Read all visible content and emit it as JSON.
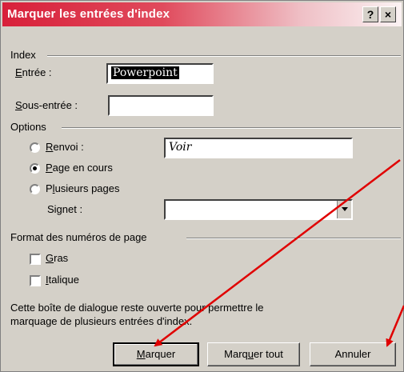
{
  "window": {
    "title": "Marquer les entrées d'index",
    "help_button": "?",
    "close_button": "×"
  },
  "index_group": {
    "label": "Index",
    "entry_label": "Entrée :",
    "entry_value": "Powerpoint",
    "subentry_label": "Sous-entrée :",
    "subentry_value": ""
  },
  "options_group": {
    "label": "Options",
    "renvoi_label": "Renvoi :",
    "renvoi_value": "Voir",
    "page_en_cours_label": "Page en cours",
    "plusieurs_pages_label": "Plusieurs pages",
    "signet_label": "Signet :",
    "signet_value": "",
    "selected": "page_en_cours"
  },
  "format_group": {
    "label": "Format des numéros de page",
    "gras_label": "Gras",
    "italique_label": "Italique",
    "gras_checked": false,
    "italique_checked": false
  },
  "help_text": {
    "line1": "Cette boîte de dialogue reste ouverte pour permettre le",
    "line2": "marquage de plusieurs entrées d'index."
  },
  "buttons": {
    "marquer": "Marquer",
    "marquer_tout": "Marquer tout",
    "annuler": "Annuler"
  },
  "colors": {
    "titlebar_start": "#d8203a",
    "dialog_bg": "#d4d0c8",
    "annotation_arrow": "#e00000"
  }
}
